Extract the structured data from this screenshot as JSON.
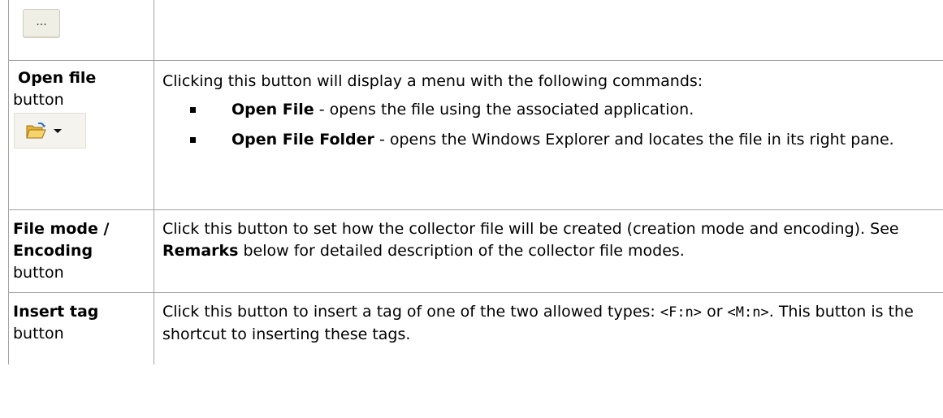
{
  "rows": {
    "ellipsis": {
      "button_label": "..."
    },
    "open_file": {
      "title": "Open file",
      "title_suffix": "button",
      "description": "Clicking this button will display a menu with the following commands:",
      "items": [
        {
          "name": "Open File",
          "text": " - opens the file using the associated application."
        },
        {
          "name": "Open File Folder",
          "text": " - opens the Windows Explorer and locates the file in its right pane."
        }
      ]
    },
    "file_mode": {
      "title_line1": "File mode /",
      "title_line2": "Encoding",
      "title_suffix": "button",
      "desc_before": "Click this button to set how the collector file will be created (creation mode and encoding). See ",
      "desc_bold": "Remarks",
      "desc_after": " below for detailed description of the collector file modes."
    },
    "insert_tag": {
      "title": "Insert tag",
      "title_suffix": "button",
      "desc_before": "Click this button to insert a tag of one of the two allowed types: ",
      "tag1": "<F:n>",
      "desc_mid": " or ",
      "tag2": "<M:n>",
      "desc_after": ". This button is the shortcut to inserting these tags."
    }
  },
  "icons": {
    "folder": "folder-open-icon",
    "dropdown": "chevron-down-icon"
  }
}
